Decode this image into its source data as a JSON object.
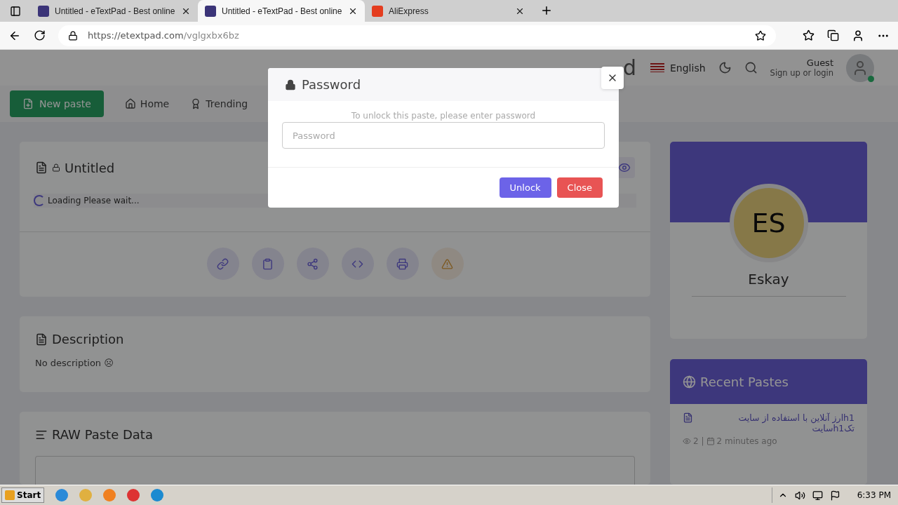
{
  "browser": {
    "tabs": [
      {
        "title": "Untitled - eTextPad - Best online",
        "selected": false,
        "kind": "etextpad"
      },
      {
        "title": "Untitled - eTextPad - Best online",
        "selected": true,
        "kind": "etextpad"
      },
      {
        "title": "AliExpress",
        "selected": false,
        "kind": "aliexpress"
      }
    ],
    "url_host": "https://etextpad.com",
    "url_path": "/vglgxbx6bz"
  },
  "header": {
    "site_title_fragment": "d",
    "language": "English",
    "user_name": "Guest",
    "user_sub": "Sign up or login"
  },
  "nav": {
    "new_paste": "New paste",
    "items": [
      {
        "label": "Home",
        "kind": "home"
      },
      {
        "label": "Trending",
        "kind": "award"
      }
    ]
  },
  "paste": {
    "title": "Untitled",
    "loading": "Loading Please wait..."
  },
  "description": {
    "title": "Description",
    "text": "No description ☹"
  },
  "raw": {
    "title": "RAW Paste Data"
  },
  "profile": {
    "initials": "ES",
    "name": "Eskay"
  },
  "recent": {
    "title": "Recent Pastes",
    "items": [
      {
        "title": "h1ارز آنلاین با استفاده از سایت تکh1سایت",
        "views": "2 |",
        "time": "2 minutes ago"
      }
    ]
  },
  "modal": {
    "title": "Password",
    "hint": "To unlock this paste, please enter password",
    "placeholder": "Password",
    "unlock": "Unlock",
    "close": "Close"
  },
  "taskbar": {
    "start": "Start",
    "clock": "6:33 PM"
  }
}
